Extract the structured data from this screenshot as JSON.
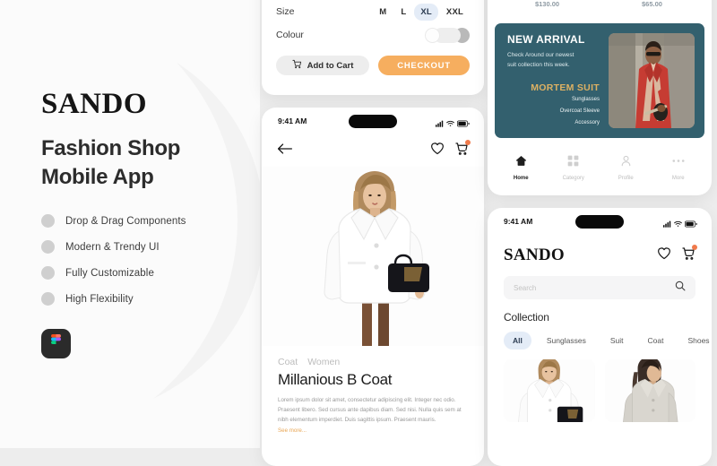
{
  "promo": {
    "brand": "SANDO",
    "headline_line1": "Fashion Shop",
    "headline_line2": "Mobile App",
    "features": [
      {
        "label": "Drop & Drag Components"
      },
      {
        "label": "Modern & Trendy UI"
      },
      {
        "label": "Fully Customizable"
      },
      {
        "label": "High Flexibility"
      }
    ],
    "figma_icon": "figma-icon"
  },
  "options_card": {
    "size": {
      "label": "Size",
      "options": [
        "M",
        "L",
        "XL",
        "XXL"
      ],
      "selected": "XL"
    },
    "colour": {
      "label": "Colour",
      "swatches": [
        "#fdfdfd",
        "#eeeeee",
        "#b9b9b9"
      ]
    },
    "add_to_cart_label": "Add to Cart",
    "add_to_cart_icon": "cart-icon",
    "checkout_label": "CHECKOUT",
    "checkout_color": "#f6ae5f"
  },
  "detail_phone": {
    "status": {
      "time": "9:41 AM",
      "icons": [
        "signal-icon",
        "wifi-icon",
        "battery-icon"
      ]
    },
    "back_icon": "back-arrow-icon",
    "heart_icon": "heart-icon",
    "cart_icon": "cart-icon",
    "tags": [
      "Coat",
      "Women"
    ],
    "title": "Millanious B Coat",
    "description": "Lorem ipsum dolor sit amet, consectetur adipiscing elit. Integer nec odio. Praesent libero. Sed cursus ante dapibus diam. Sed nisi. Nulla quis sem at nibh elementum imperdiet. Duis sagittis ipsum. Praesent mauris.",
    "see_more": "See more..."
  },
  "arrival_card": {
    "prices": [
      "$130.00",
      "$65.00"
    ],
    "banner": {
      "title": "NEW ARRIVAL",
      "subtitle_line1": "Check Around our newest",
      "subtitle_line2": "suit collection this week.",
      "product": "MORTEM SUIT",
      "features": [
        "Sunglasses",
        "Overcoat Sleeve",
        "Accessory"
      ],
      "bg_color": "#33606e",
      "accent_color": "#ddb163"
    },
    "nav": [
      {
        "label": "Home",
        "icon": "home-icon",
        "active": true
      },
      {
        "label": "Category",
        "icon": "grid-icon",
        "active": false
      },
      {
        "label": "Profile",
        "icon": "person-icon",
        "active": false
      },
      {
        "label": "More",
        "icon": "ellipsis-icon",
        "active": false
      }
    ]
  },
  "home_phone": {
    "status": {
      "time": "9:41 AM",
      "icons": [
        "signal-icon",
        "wifi-icon",
        "battery-icon"
      ]
    },
    "logo": "SANDO",
    "heart_icon": "heart-icon",
    "cart_icon": "cart-icon",
    "search_placeholder": "Search",
    "search_icon": "search-icon",
    "collection_label": "Collection",
    "chips": [
      {
        "label": "All",
        "active": true
      },
      {
        "label": "Sunglasses",
        "active": false
      },
      {
        "label": "Suit",
        "active": false
      },
      {
        "label": "Coat",
        "active": false
      },
      {
        "label": "Shoes",
        "active": false
      }
    ]
  }
}
